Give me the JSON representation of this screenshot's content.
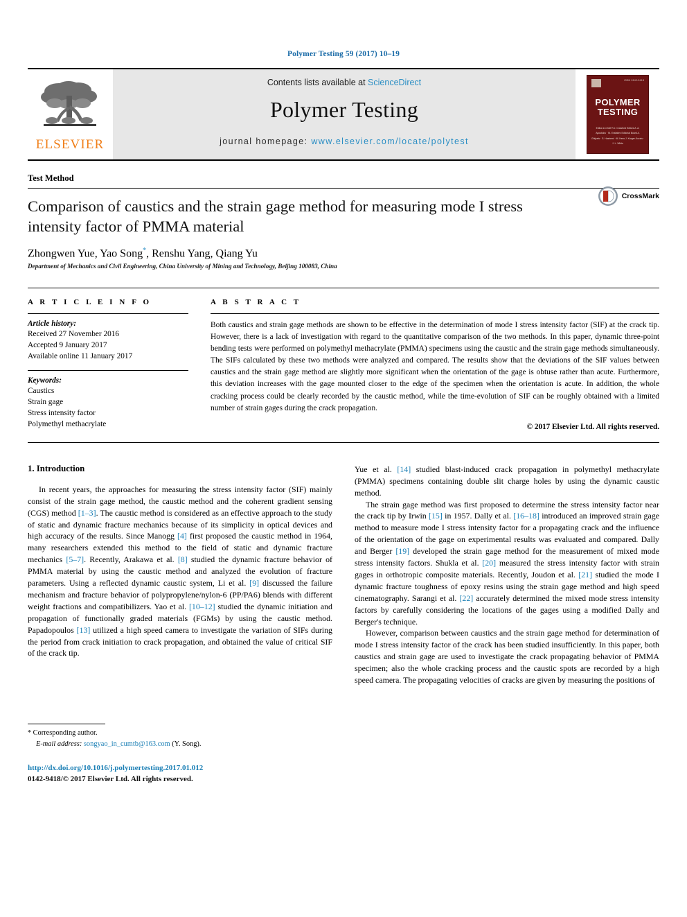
{
  "running_head": "Polymer Testing 59 (2017) 10–19",
  "masthead": {
    "publisher_name": "ELSEVIER",
    "contents_prefix": "Contents lists available at",
    "contents_link": "ScienceDirect",
    "journal_title": "Polymer Testing",
    "homepage_prefix": "journal homepage:",
    "homepage_url": "www.elsevier.com/locate/polytest",
    "cover": {
      "title_line1": "POLYMER",
      "title_line2": "TESTING",
      "code": "ISSN 0142-9418",
      "sub_text": "Editor-in-Chief\nR.J. Crawford\nEditors\nA. A. Apostolov · M. Evstatiev\nEditorial Board\nA. Ghijsels · S. Hashemi · M. Hess\nJ. Karger-Kocsis · J. L. White"
    }
  },
  "article": {
    "kind": "Test Method",
    "title": "Comparison of caustics and the strain gage method for measuring mode I stress intensity factor of PMMA material",
    "authors": "Zhongwen Yue, Yao Song",
    "author_marker": "*",
    "authors_tail": ", Renshu Yang, Qiang Yu",
    "affiliation": "Department of Mechanics and Civil Engineering, China University of Mining and Technology, Beijing 100083, China",
    "crossmark_label": "CrossMark"
  },
  "info": {
    "heading": "A R T I C L E   I N F O",
    "history_label": "Article history:",
    "history": [
      "Received 27 November 2016",
      "Accepted 9 January 2017",
      "Available online 11 January 2017"
    ],
    "keywords_label": "Keywords:",
    "keywords": [
      "Caustics",
      "Strain gage",
      "Stress intensity factor",
      "Polymethyl methacrylate"
    ]
  },
  "abstract": {
    "heading": "A B S T R A C T",
    "text": "Both caustics and strain gage methods are shown to be effective in the determination of mode I stress intensity factor (SIF) at the crack tip. However, there is a lack of investigation with regard to the quantitative comparison of the two methods. In this paper, dynamic three-point bending tests were performed on polymethyl methacrylate (PMMA) specimens using the caustic and the strain gage methods simultaneously. The SIFs calculated by these two methods were analyzed and compared. The results show that the deviations of the SIF values between caustics and the strain gage method are slightly more significant when the orientation of the gage is obtuse rather than acute. Furthermore, this deviation increases with the gage mounted closer to the edge of the specimen when the orientation is acute. In addition, the whole cracking process could be clearly recorded by the caustic method, while the time-evolution of SIF can be roughly obtained with a limited number of strain gages during the crack propagation.",
    "copyright": "© 2017 Elsevier Ltd. All rights reserved."
  },
  "body": {
    "section_number_title": "1.  Introduction",
    "left_paragraph_1": "In recent years, the approaches for measuring the stress intensity factor (SIF) mainly consist of the strain gage method, the caustic method and the coherent gradient sensing (CGS) method [1–3]. The caustic method is considered as an effective approach to the study of static and dynamic fracture mechanics because of its simplicity in optical devices and high accuracy of the results. Since Manogg [4] first proposed the caustic method in 1964, many researchers extended this method to the field of static and dynamic fracture mechanics [5–7]. Recently, Arakawa et al. [8] studied the dynamic fracture behavior of PMMA material by using the caustic method and analyzed the evolution of fracture parameters. Using a reflected dynamic caustic system, Li et al. [9] discussed the failure mechanism and fracture behavior of polypropylene/nylon-6 (PP/PA6) blends with different weight fractions and compatibilizers. Yao et al. [10–12] studied the dynamic initiation and propagation of functionally graded materials (FGMs) by using the caustic method. Papadopoulos [13] utilized a high speed camera to investigate the variation of SIFs during the period from crack initiation to crack propagation, and obtained the value of critical SIF of the crack tip.",
    "right_paragraph_1": "Yue et al. [14] studied blast-induced crack propagation in polymethyl methacrylate (PMMA) specimens containing double slit charge holes by using the dynamic caustic method.",
    "right_paragraph_2": "The strain gage method was first proposed to determine the stress intensity factor near the crack tip by Irwin [15] in 1957. Dally et al. [16–18] introduced an improved strain gage method to measure mode I stress intensity factor for a propagating crack and the influence of the orientation of the gage on experimental results was evaluated and compared. Dally and Berger [19] developed the strain gage method for the measurement of mixed mode stress intensity factors. Shukla et al. [20] measured the stress intensity factor with strain gages in orthotropic composite materials. Recently, Joudon et al. [21] studied the mode I dynamic fracture toughness of epoxy resins using the strain gage method and high speed cinematography. Sarangi et al. [22] accurately determined the mixed mode stress intensity factors by carefully considering the locations of the gages using a modified Dally and Berger's technique.",
    "right_paragraph_3": "However, comparison between caustics and the strain gage method for determination of mode I stress intensity factor of the crack has been studied insufficiently. In this paper, both caustics and strain gage are used to investigate the crack propagating behavior of PMMA specimen; also the whole cracking process and the caustic spots are recorded by a high speed camera. The propagating velocities of cracks are given by measuring the positions of"
  },
  "footer": {
    "corresponding_marker": "*",
    "corresponding_text": "Corresponding author.",
    "email_label": "E-mail address:",
    "email": "songyao_in_cumtb@163.com",
    "email_attrib": "(Y. Song).",
    "doi_url": "http://dx.doi.org/10.1016/j.polymertesting.2017.01.012",
    "issn_line": "0142-9418/© 2017 Elsevier Ltd. All rights reserved."
  },
  "colors": {
    "link_blue": "#1b7fb5",
    "sciencedirect_blue": "#2a8ec4",
    "elsevier_orange": "#f07f1a",
    "cover_maroon": "#6b1414",
    "band_gray": "#e7e7e7"
  }
}
